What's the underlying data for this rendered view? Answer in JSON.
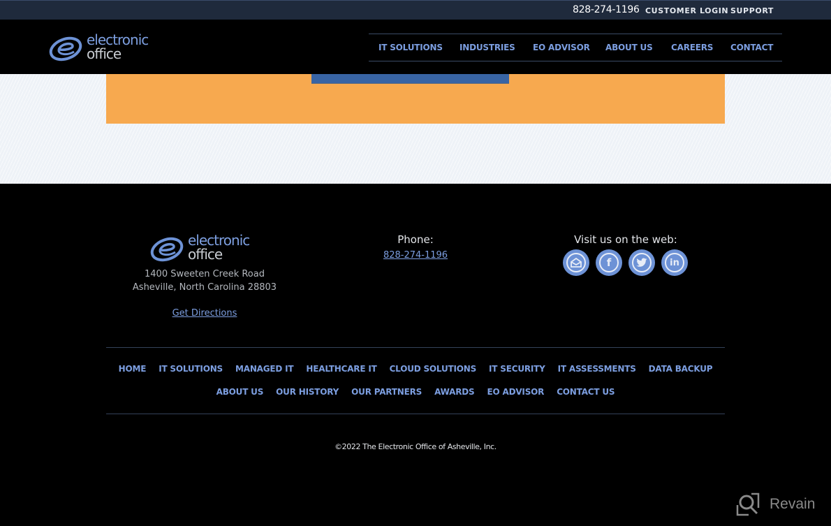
{
  "topbar": {
    "phone": "828-274-1196",
    "customer_login": "CUSTOMER LOGIN",
    "support": "SUPPORT"
  },
  "logo": {
    "line1": "electronic",
    "line2": "office",
    "icon": "swirl-e-logo-icon"
  },
  "main_nav": {
    "items": [
      {
        "label": "IT SOLUTIONS"
      },
      {
        "label": "INDUSTRIES"
      },
      {
        "label": "EO ADVISOR"
      },
      {
        "label": "ABOUT US"
      },
      {
        "label": "CAREERS"
      },
      {
        "label": "CONTACT"
      }
    ]
  },
  "colors": {
    "accent_blue": "#7c9ee0",
    "orange_panel": "#f7a94f",
    "button_blue": "#3864a4",
    "topbar_bg": "#1f2a3c"
  },
  "footer": {
    "address_line1": "1400 Sweeten Creek Road",
    "address_line2": "Asheville, North Carolina 28803",
    "directions": "Get Directions",
    "phone_label": "Phone:",
    "phone": "828-274-1196",
    "social_label": "Visit us on the web:",
    "social": [
      {
        "name": "email",
        "icon": "email-icon",
        "glyph": "✉"
      },
      {
        "name": "facebook",
        "icon": "facebook-icon",
        "glyph": "f"
      },
      {
        "name": "twitter",
        "icon": "twitter-icon",
        "glyph": "🐦"
      },
      {
        "name": "linkedin",
        "icon": "linkedin-icon",
        "glyph": "in"
      }
    ],
    "nav_row1": [
      {
        "label": "HOME"
      },
      {
        "label": "IT SOLUTIONS"
      },
      {
        "label": "MANAGED IT"
      },
      {
        "label": "HEALTHCARE IT"
      },
      {
        "label": "CLOUD SOLUTIONS"
      },
      {
        "label": "IT SECURITY"
      },
      {
        "label": "IT ASSESSMENTS"
      },
      {
        "label": "DATA BACKUP"
      }
    ],
    "nav_row2": [
      {
        "label": "ABOUT US"
      },
      {
        "label": "OUR HISTORY"
      },
      {
        "label": "OUR PARTNERS"
      },
      {
        "label": "AWARDS"
      },
      {
        "label": "EO ADVISOR"
      },
      {
        "label": "CONTACT US"
      }
    ],
    "copyright": "©2022 The Electronic Office of Asheville, Inc."
  },
  "watermark": {
    "text": "Revain"
  }
}
